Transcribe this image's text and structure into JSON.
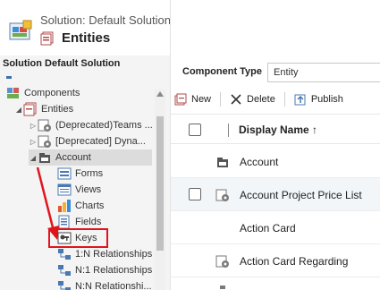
{
  "header": {
    "subtitle": "Solution: Default Solution",
    "title": "Entities"
  },
  "sidebar": {
    "solution_title": "Solution Default Solution",
    "items": [
      {
        "label": "Components"
      },
      {
        "label": "Entities"
      },
      {
        "label": "(Deprecated)Teams ..."
      },
      {
        "label": "[Deprecated] Dyna..."
      },
      {
        "label": "Account"
      },
      {
        "label": "Forms"
      },
      {
        "label": "Views"
      },
      {
        "label": "Charts"
      },
      {
        "label": "Fields"
      },
      {
        "label": "Keys"
      },
      {
        "label": "1:N Relationships"
      },
      {
        "label": "N:1 Relationships"
      },
      {
        "label": "N:N Relationshi..."
      }
    ]
  },
  "main": {
    "component_type_label": "Component Type",
    "component_type_value": "Entity",
    "toolbar": {
      "new_label": "New",
      "delete_label": "Delete",
      "publish_label": "Publish"
    },
    "grid": {
      "column_header": "Display Name ↑",
      "rows": [
        {
          "name": "Account",
          "icon": "account-entity-icon"
        },
        {
          "name": "Account Project Price List",
          "icon": "gear-entity-icon"
        },
        {
          "name": "Action Card",
          "icon": ""
        },
        {
          "name": "Action Card Regarding",
          "icon": "gear-entity-icon"
        }
      ]
    }
  },
  "colors": {
    "highlight_red": "#e0141b",
    "sidebar_bg": "#f4f4f4",
    "selected_bg": "#dcdcdc"
  }
}
